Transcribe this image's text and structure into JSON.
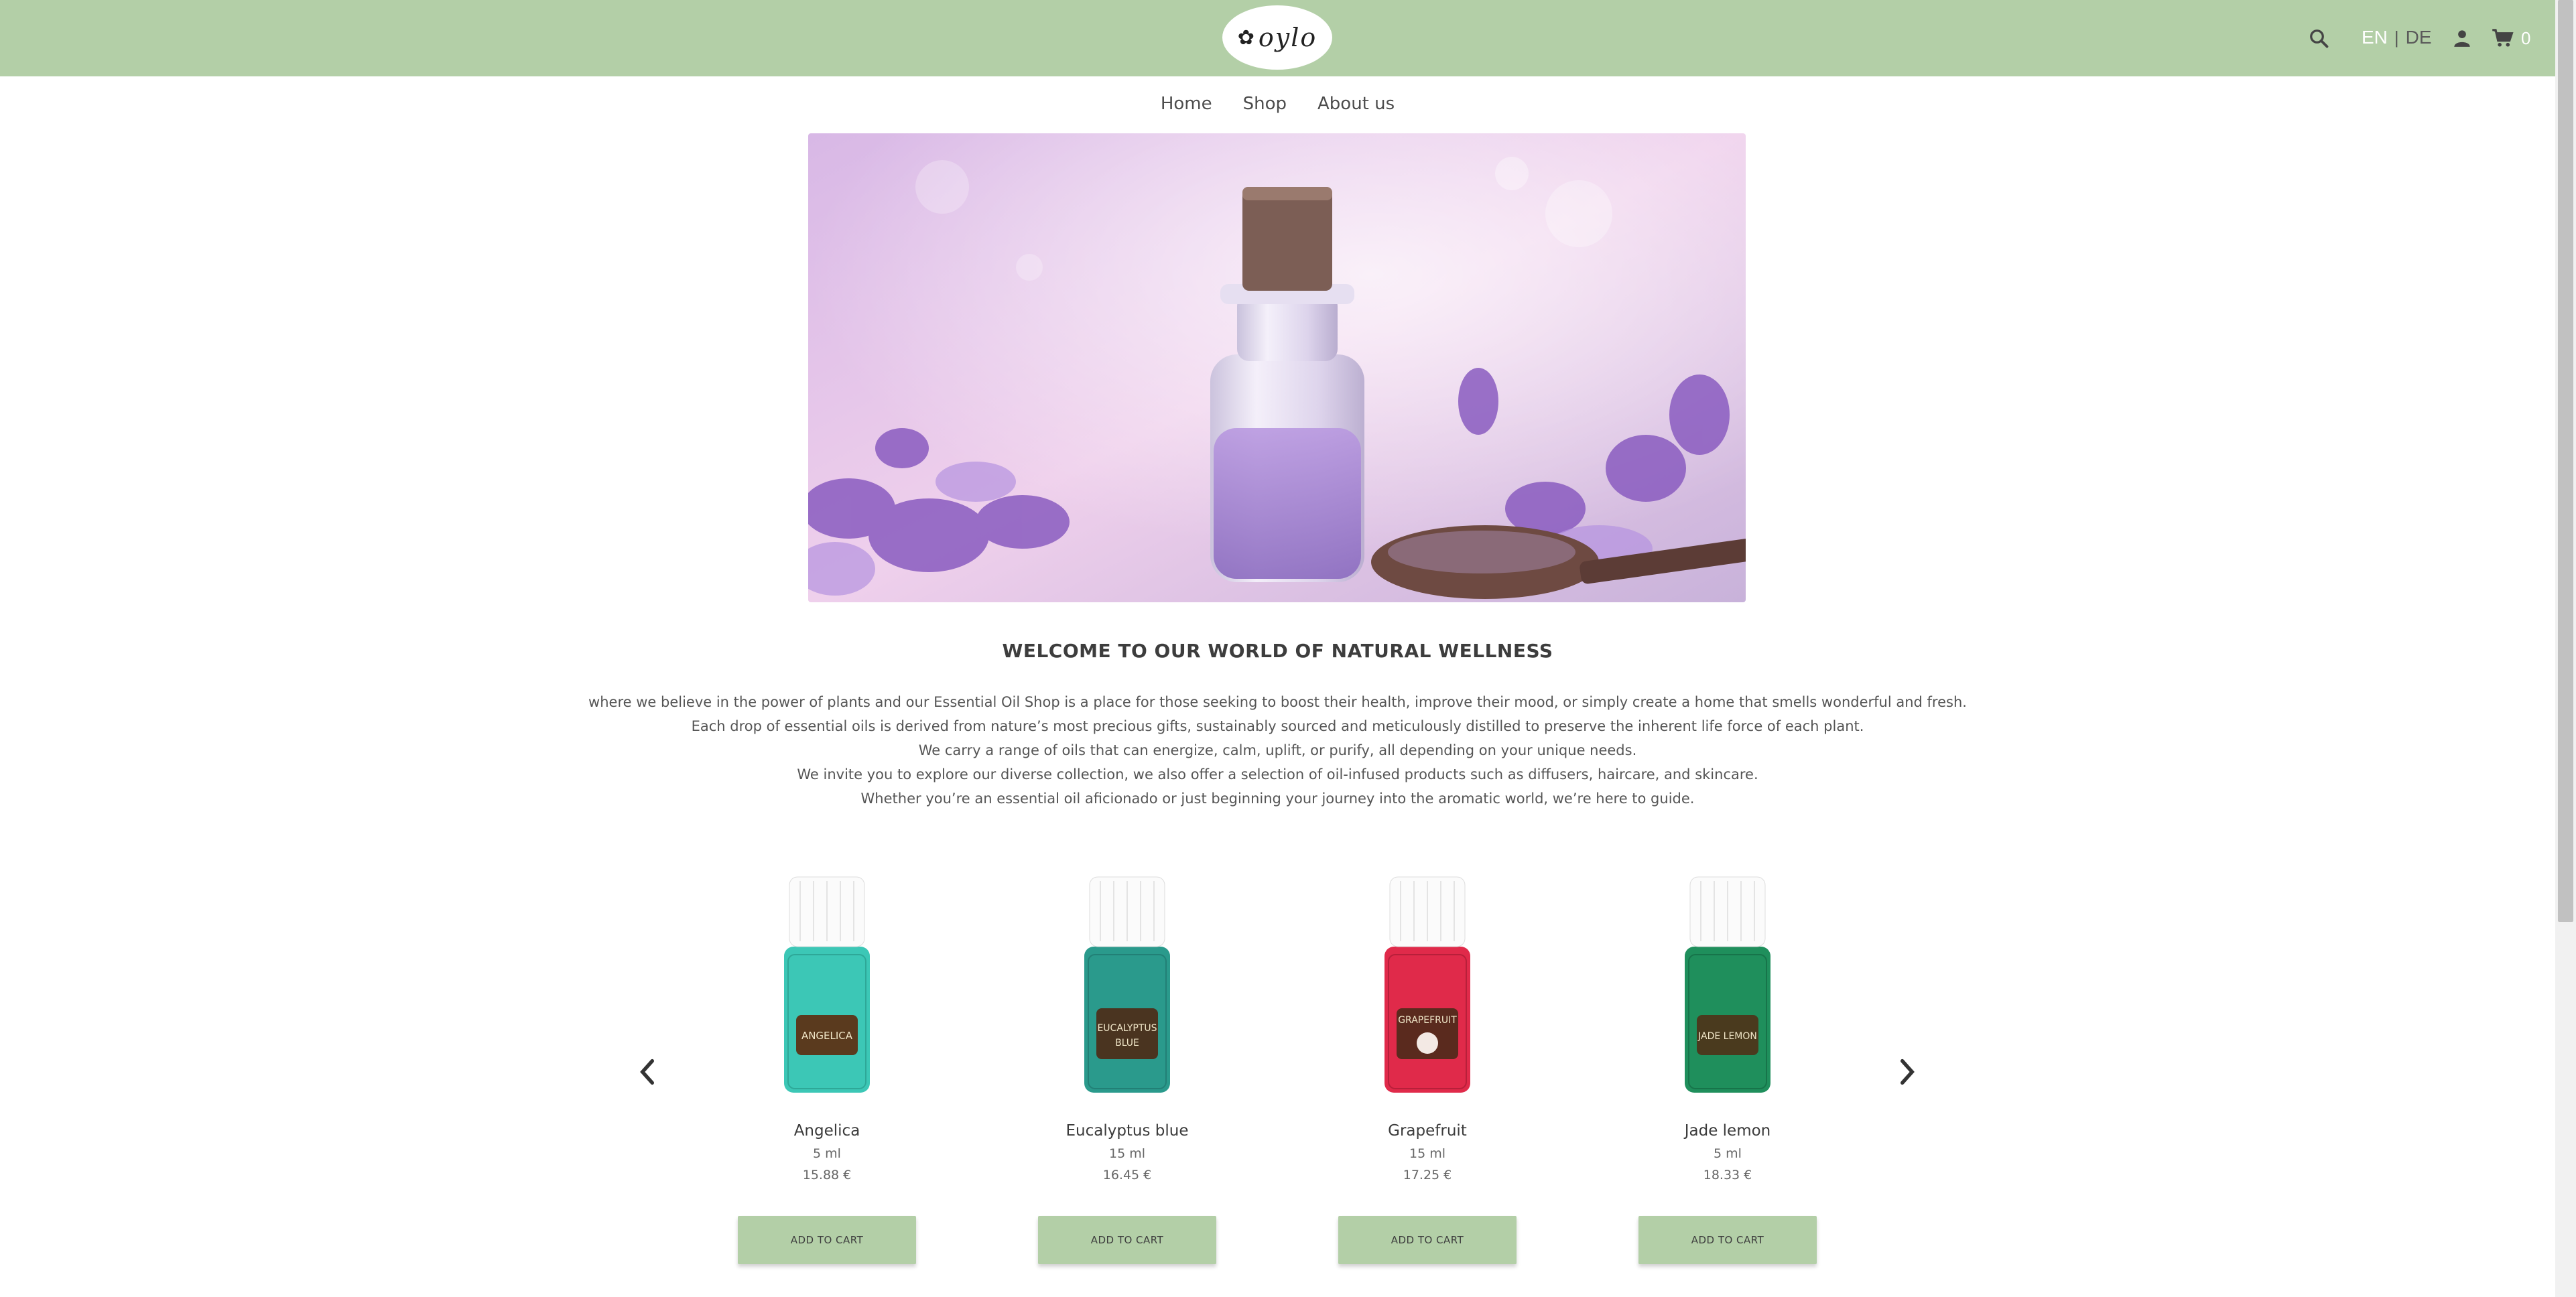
{
  "header": {
    "logo_text": "oylo",
    "lang_en": "EN",
    "lang_separator": "|",
    "lang_de": "DE",
    "cart_count": "0"
  },
  "nav": {
    "items": [
      "Home",
      "Shop",
      "About us"
    ]
  },
  "hero": {
    "image": "essential-oil-bottle-lavender"
  },
  "welcome": {
    "title": "WELCOME TO OUR WORLD OF NATURAL WELLNESS",
    "lines": [
      "where we believe in the power of plants and our Essential Oil Shop is a place for those seeking to boost their health, improve their mood, or simply create a home that smells wonderful and fresh.",
      "Each drop of essential oils is derived from nature’s most precious gifts, sustainably sourced and meticulously distilled to preserve the inherent life force of each plant.",
      "We carry a range of oils that can energize, calm, uplift, or purify, all depending on your unique needs.",
      "We invite you to explore our diverse collection, we also offer a selection of oil-infused products such as diffusers, haircare, and skincare.",
      "Whether you’re an essential oil aficionado or just beginning your journey into the aromatic world, we’re here to guide."
    ]
  },
  "products": [
    {
      "name": "Angelica",
      "size": "5 ml",
      "price": "15.88 €",
      "button": "ADD TO CART",
      "label": "ANGELICA",
      "label2": "",
      "color": "#3cc7b6"
    },
    {
      "name": "Eucalyptus blue",
      "size": "15 ml",
      "price": "16.45 €",
      "button": "ADD TO CART",
      "label": "EUCALYPTUS",
      "label2": "BLUE",
      "color": "#2a9a8c"
    },
    {
      "name": "Grapefruit",
      "size": "15 ml",
      "price": "17.25 €",
      "button": "ADD TO CART",
      "label": "GRAPEFRUIT",
      "label2": "",
      "color": "#e02a4a"
    },
    {
      "name": "Jade lemon",
      "size": "5 ml",
      "price": "18.33 €",
      "button": "ADD TO CART",
      "label": "JADE LEMON",
      "label2": "",
      "color": "#1f8f5c"
    }
  ],
  "colors": {
    "header_bg": "#b3cfa7",
    "button_bg": "#b3cfa7"
  }
}
